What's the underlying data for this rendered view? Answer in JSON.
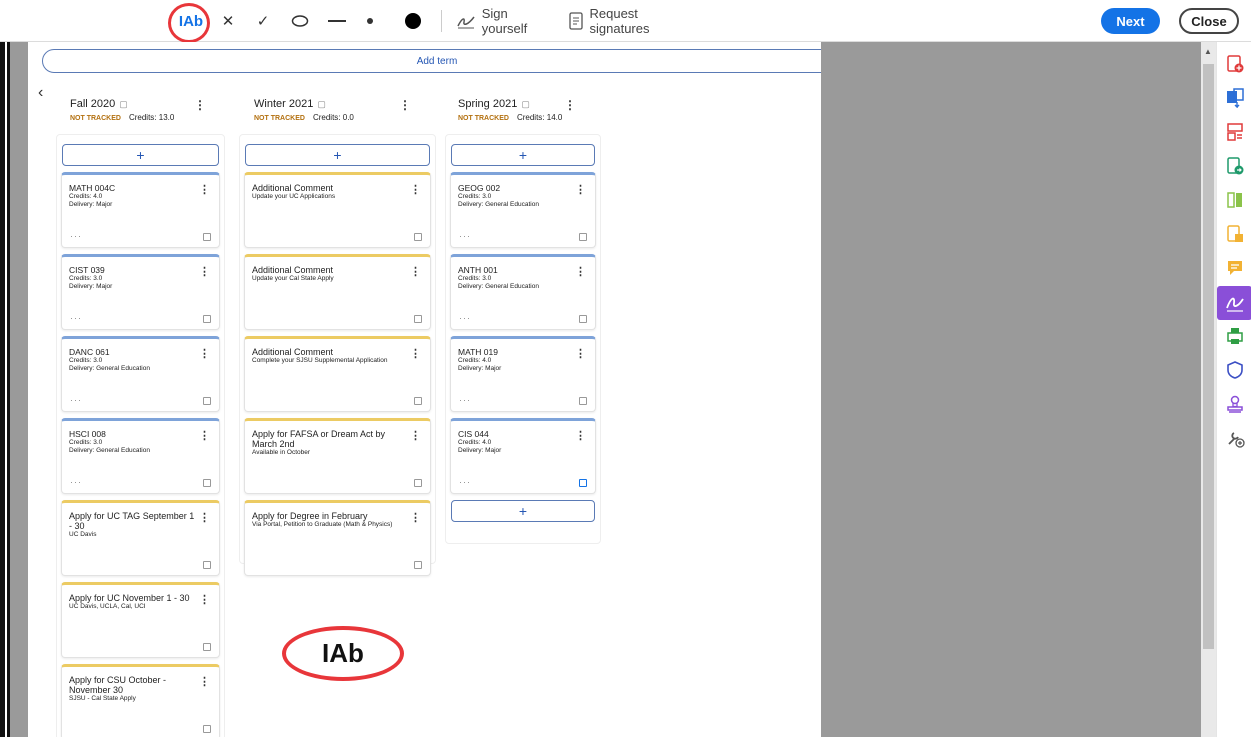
{
  "toolbar": {
    "text_tool": "IAb",
    "cross_tool": "✕",
    "check_tool": "✓",
    "sign_yourself": "Sign yourself",
    "request_signatures": "Request signatures",
    "next": "Next",
    "close": "Close"
  },
  "planner": {
    "add_term": "Add term",
    "terms": [
      {
        "name": "Fall 2020",
        "status": "NOT TRACKED",
        "credits": "Credits: 13.0"
      },
      {
        "name": "Winter 2021",
        "status": "NOT TRACKED",
        "credits": "Credits: 0.0"
      },
      {
        "name": "Spring 2021",
        "status": "NOT TRACKED",
        "credits": "Credits: 14.0"
      }
    ],
    "columns": {
      "fall": [
        {
          "title": "MATH 004C",
          "lines": [
            "Credits: 4.0",
            "Delivery: Major"
          ]
        },
        {
          "title": "CIST 039",
          "lines": [
            "Credits: 3.0",
            "Delivery: Major"
          ]
        },
        {
          "title": "DANC 061",
          "lines": [
            "Credits: 3.0",
            "Delivery: General Education"
          ]
        },
        {
          "title": "HSCI 008",
          "lines": [
            "Credits: 3.0",
            "Delivery: General Education"
          ]
        },
        {
          "title": "Apply for UC TAG September 1 - 30",
          "lines": [
            "UC Davis"
          ]
        },
        {
          "title": "Apply for UC November 1 - 30",
          "lines": [
            "UC Davis, UCLA, Cal, UCI"
          ]
        },
        {
          "title": "Apply for CSU October - November 30",
          "lines": [
            "SJSU - Cal State Apply"
          ]
        }
      ],
      "winter": [
        {
          "title": "Additional Comment",
          "lines": [
            "Update your UC Applications"
          ]
        },
        {
          "title": "Additional Comment",
          "lines": [
            "Update your Cal State Apply"
          ]
        },
        {
          "title": "Additional Comment",
          "lines": [
            "Complete your SJSU Supplemental Application"
          ]
        },
        {
          "title": "Apply for FAFSA or Dream Act by March 2nd",
          "lines": [
            "Available in October"
          ]
        },
        {
          "title": "Apply for Degree in February",
          "lines": [
            "Via Portal, Petition to Graduate (Math & Physics)"
          ]
        }
      ],
      "spring": [
        {
          "title": "GEOG 002",
          "lines": [
            "Credits: 3.0",
            "Delivery: General Education"
          ]
        },
        {
          "title": "ANTH 001",
          "lines": [
            "Credits: 3.0",
            "Delivery: General Education"
          ]
        },
        {
          "title": "MATH 019",
          "lines": [
            "Credits: 4.0",
            "Delivery: Major"
          ]
        },
        {
          "title": "CIS 044",
          "lines": [
            "Credits: 4.0",
            "Delivery: Major"
          ]
        }
      ]
    },
    "add_symbol": "+",
    "more_symbol": "⋮",
    "ellipsis": "···"
  },
  "annotation": {
    "big_label": "IAb"
  },
  "colors": {
    "accent": "#1473e6",
    "highlight": "#e8363a",
    "not_tracked": "#b3700f",
    "rail_active": "#8a4fd8"
  }
}
